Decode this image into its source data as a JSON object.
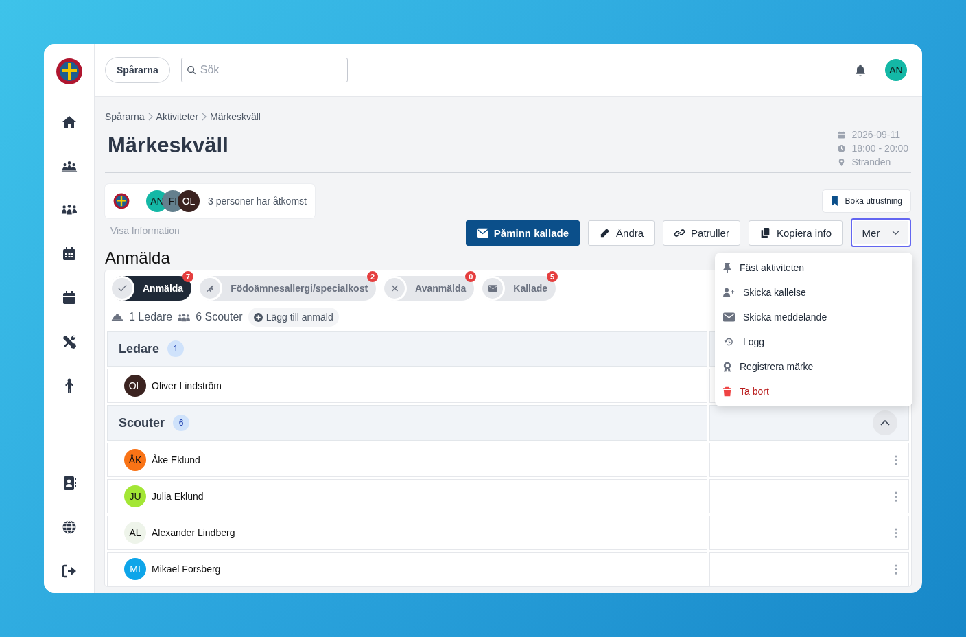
{
  "org": {
    "name": "Spårarna"
  },
  "search": {
    "placeholder": "Sök"
  },
  "user": {
    "initials": "AN",
    "color": "#14b8a6"
  },
  "breadcrumb": [
    "Spårarna",
    "Aktiviteter",
    "Märkeskväll"
  ],
  "title": "Märkeskväll",
  "meta": {
    "date": "2026-09-11",
    "time": "18:00 - 20:00",
    "place": "Stranden"
  },
  "access": {
    "avatars": [
      {
        "initials": "AN",
        "color": "#14b8a6"
      },
      {
        "initials": "FI",
        "color": "#64808e"
      },
      {
        "initials": "OL",
        "color": "#3b2320"
      }
    ],
    "text": "3 personer har åtkomst"
  },
  "info_link": "Visa Information",
  "booking_button": "Boka utrustning",
  "actions": [
    {
      "label": "Påminn kallade",
      "kind": "primary"
    },
    {
      "label": "Ändra",
      "kind": "edit"
    },
    {
      "label": "Patruller",
      "kind": "link"
    },
    {
      "label": "Kopiera info",
      "kind": "copy"
    }
  ],
  "more": {
    "label": "Mer",
    "expanded": true
  },
  "menu": [
    {
      "label": "Fäst aktiviteten",
      "kind": "pin"
    },
    {
      "label": "Skicka kallelse",
      "kind": "invite"
    },
    {
      "label": "Skicka meddelande",
      "kind": "message"
    },
    {
      "label": "Logg",
      "kind": "history"
    },
    {
      "label": "Registrera märke",
      "kind": "badge"
    },
    {
      "label": "Ta bort",
      "kind": "delete"
    }
  ],
  "section_title": "Anmälda",
  "filter_tabs": [
    {
      "label": "Anmälda",
      "count": "7",
      "kind": "check",
      "selected": true
    },
    {
      "label": "Födoämnesallergi/specialkost",
      "count": "2",
      "kind": "wheat",
      "selected": false
    },
    {
      "label": "Avanmälda",
      "count": "0",
      "kind": "cross",
      "selected": false
    },
    {
      "label": "Kallade",
      "count": "5",
      "kind": "mail",
      "selected": false
    }
  ],
  "stats": [
    {
      "text": "1 Ledare",
      "kind": "leader"
    },
    {
      "text": "6 Scouter",
      "kind": "scouts"
    }
  ],
  "add_button": "Lägg till anmäld",
  "groups": [
    {
      "title": "Ledare",
      "count": "1",
      "members": [
        {
          "initials": "OL",
          "name": "Oliver Lindström",
          "color": "#3b2320"
        }
      ]
    },
    {
      "title": "Scouter",
      "count": "6",
      "expanded": true,
      "members": [
        {
          "initials": "ÅK",
          "name": "Åke Eklund",
          "color": "#f97316"
        },
        {
          "initials": "JU",
          "name": "Julia Eklund",
          "color": "#a3e635"
        },
        {
          "initials": "AL",
          "name": "Alexander Lindberg",
          "color": "#eef4ea"
        },
        {
          "initials": "MI",
          "name": "Mikael Forsberg",
          "color": "#0ea5e9"
        }
      ]
    }
  ]
}
